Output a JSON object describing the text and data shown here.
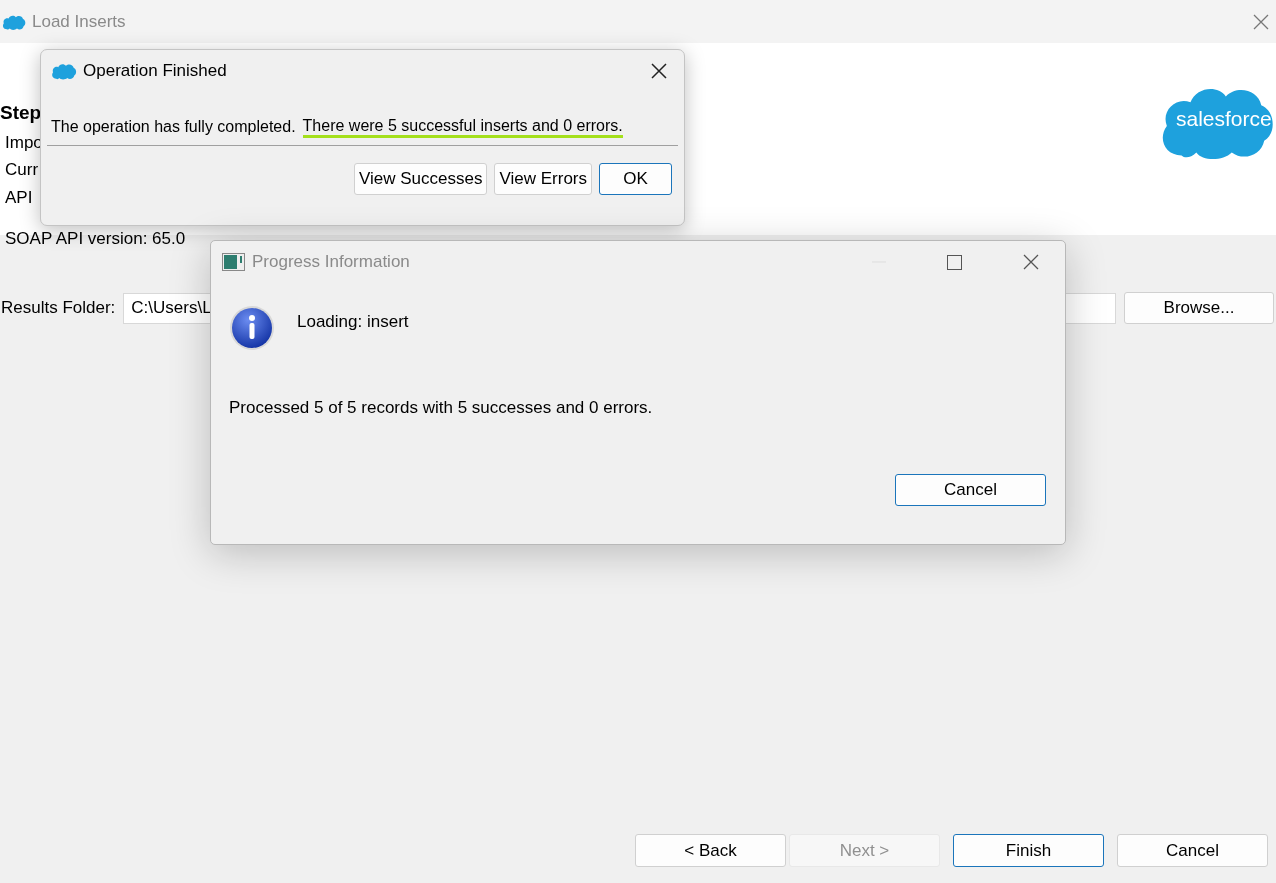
{
  "window": {
    "title": "Load Inserts"
  },
  "header": {
    "lines": [
      {
        "text": "Step",
        "kind": "heading"
      },
      {
        "text": "Impo",
        "kind": "line"
      },
      {
        "text": "Curr",
        "kind": "line"
      },
      {
        "text": "API",
        "kind": "line"
      },
      {
        "text": "SOAP API version: 65.0",
        "kind": "line"
      }
    ],
    "logo": "salesforce"
  },
  "results_folder": {
    "label": "Results Folder:",
    "value": "C:\\Users\\L",
    "browse": "Browse..."
  },
  "wizard_buttons": [
    {
      "label": "< Back",
      "disabled": false,
      "default": false
    },
    {
      "label": "Next >",
      "disabled": true,
      "default": false
    },
    {
      "label": "Finish",
      "disabled": false,
      "default": true
    },
    {
      "label": "Cancel",
      "disabled": false,
      "default": false
    }
  ],
  "operation_dialog": {
    "title": "Operation Finished",
    "message": "The operation has fully completed.",
    "highlighted_message": "There were 5 successful inserts and 0 errors.",
    "buttons": [
      {
        "label": "View Successes",
        "default": false
      },
      {
        "label": "View Errors",
        "default": false
      },
      {
        "label": "OK",
        "default": true
      }
    ]
  },
  "progress_dialog": {
    "title": "Progress Information",
    "status": "Loading: insert",
    "detail": "Processed 5 of 5 records with 5 successes and 0 errors.",
    "button": "Cancel"
  }
}
